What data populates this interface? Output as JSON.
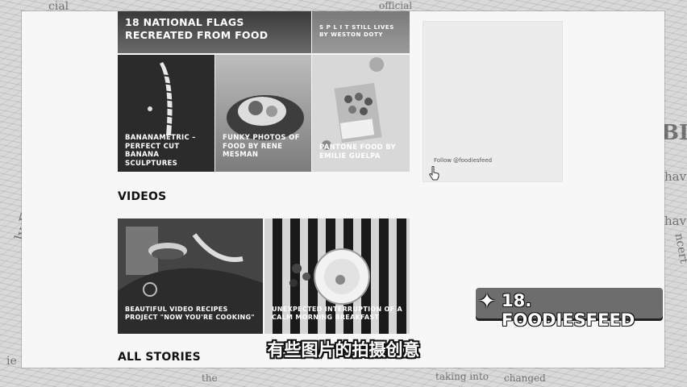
{
  "gallery": {
    "top_left_title": "18 NATIONAL FLAGS RECREATED FROM FOOD",
    "top_right_title": "S P L I T STILL LIVES BY WESTON DOTY",
    "tile_1_title": "BANANAMETRIC – PERFECT CUT BANANA SCULPTURES",
    "tile_2_title": "FUNKY PHOTOS OF FOOD BY RENE MESMAN",
    "tile_3_title": "PANTONE FOOD BY EMILIE GUELPA"
  },
  "sidebar": {
    "follow_text": "Follow @foodiesfeed"
  },
  "videos": {
    "heading": "VIDEOS",
    "video_1_title": "BEAUTIFUL VIDEO RECIPES PROJECT \"NOW YOU'RE COOKING\"",
    "video_2_title": "UNEXPECTED INTERRUPTION OF A CALM MORNING BREAKFAST"
  },
  "all_stories": {
    "heading": "ALL STORIES"
  },
  "overlay": {
    "badge_text": "18. FOODIESFEED",
    "badge_icon": "sparkle-icon",
    "subtitle": "有些图片的拍摄创意"
  },
  "background_words": [
    "commun",
    "ly Europ",
    "BIG",
    "have",
    "have",
    "ncert",
    "taking into",
    "changed",
    "cial",
    "the",
    "official",
    "ie"
  ]
}
